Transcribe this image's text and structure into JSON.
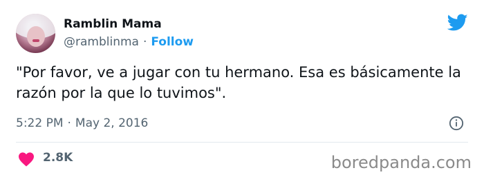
{
  "tweet": {
    "author_name": "Ramblin Mama",
    "handle": "@ramblinma",
    "separator": "·",
    "follow_label": "Follow",
    "text": "\"Por favor, ve a jugar con tu hermano. Esa es básicamente la razón por la que lo tuvimos\".",
    "time": "5:22 PM",
    "date": "May 2, 2016",
    "likes": "2.8K"
  },
  "icons": {
    "brand": "twitter-bird-icon",
    "info": "info-icon",
    "like": "heart-icon"
  },
  "colors": {
    "accent": "#1d9bf0",
    "like": "#f91880",
    "text": "#0f1419",
    "secondary": "#536471"
  },
  "watermark": "boredpanda.com"
}
